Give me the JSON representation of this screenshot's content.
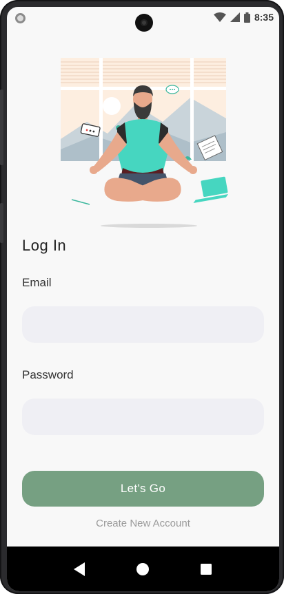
{
  "status_bar": {
    "time": "8:35",
    "icons": [
      "notification-dot-icon",
      "wifi-icon",
      "signal-icon",
      "battery-icon"
    ]
  },
  "login": {
    "title": "Log In",
    "email_label": "Email",
    "email_value": "",
    "password_label": "Password",
    "password_value": "",
    "submit_label": "Let's Go",
    "create_account_label": "Create New Account"
  },
  "navigation": {
    "keys": [
      "back-icon",
      "home-icon",
      "recents-icon"
    ]
  },
  "colors": {
    "accent": "#76a082",
    "field_background": "#efeff4",
    "screen_background": "#f8f8f8"
  }
}
